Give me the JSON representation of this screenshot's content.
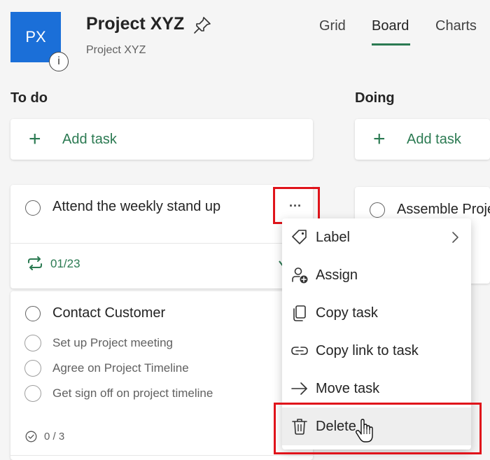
{
  "header": {
    "avatar_initials": "PX",
    "info_badge": "i",
    "title": "Project XYZ",
    "subtitle": "Project XYZ",
    "tabs": [
      {
        "label": "Grid",
        "active": false
      },
      {
        "label": "Board",
        "active": true
      },
      {
        "label": "Charts",
        "active": false
      }
    ]
  },
  "columns": [
    {
      "name": "To do",
      "add_task_label": "Add task",
      "tasks": [
        {
          "title": "Attend the weekly stand up",
          "due": "01/23",
          "more_label": "···"
        },
        {
          "title": "Contact Customer",
          "subtasks": [
            "Set up Project meeting",
            "Agree on Project Timeline",
            "Get sign off on project timeline"
          ],
          "checklist_count": "0 / 3"
        }
      ]
    },
    {
      "name": "Doing",
      "add_task_label": "Add task",
      "tasks": [
        {
          "title": "Assemble Proje"
        }
      ]
    }
  ],
  "context_menu": {
    "items": [
      {
        "label": "Label",
        "icon": "tag-icon",
        "has_submenu": true
      },
      {
        "label": "Assign",
        "icon": "person-add-icon"
      },
      {
        "label": "Copy task",
        "icon": "copy-icon"
      },
      {
        "label": "Copy link to task",
        "icon": "link-icon"
      },
      {
        "label": "Move task",
        "icon": "arrow-right-icon"
      },
      {
        "label": "Delete",
        "icon": "trash-icon",
        "hovered": true
      }
    ]
  },
  "colors": {
    "accent": "#2b7a52",
    "avatar": "#1b6fd8",
    "highlight": "#e0141b"
  }
}
